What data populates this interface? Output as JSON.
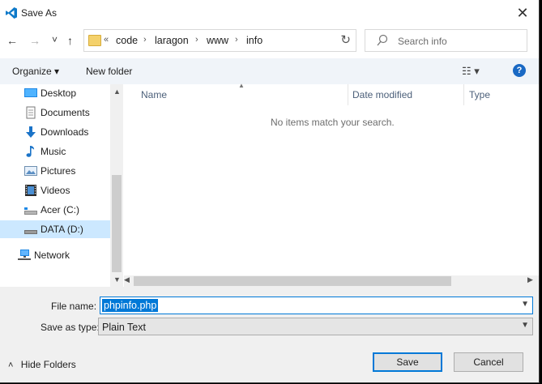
{
  "window": {
    "title": "Save As",
    "close_glyph": "✕"
  },
  "nav": {
    "back": "←",
    "forward": "→",
    "recent": "˅",
    "up": "↑"
  },
  "address": {
    "overflow": "«",
    "crumbs": [
      "code",
      "laragon",
      "www",
      "info"
    ],
    "separator": "›",
    "refresh": "↻"
  },
  "search": {
    "placeholder": "Search info"
  },
  "toolbar": {
    "organize": "Organize ▾",
    "new_folder": "New folder",
    "view": "☷ ▾",
    "help": "?"
  },
  "sidebar": {
    "items": [
      {
        "label": "Desktop",
        "icon": "desktop-icon"
      },
      {
        "label": "Documents",
        "icon": "documents-icon"
      },
      {
        "label": "Downloads",
        "icon": "downloads-icon"
      },
      {
        "label": "Music",
        "icon": "music-icon"
      },
      {
        "label": "Pictures",
        "icon": "pictures-icon"
      },
      {
        "label": "Videos",
        "icon": "videos-icon"
      },
      {
        "label": "Acer (C:)",
        "icon": "drive-icon"
      },
      {
        "label": "DATA (D:)",
        "icon": "drive-icon",
        "selected": true
      },
      {
        "label": "Network",
        "icon": "network-icon"
      }
    ]
  },
  "columns": {
    "name": "Name",
    "date_modified": "Date modified",
    "type": "Type"
  },
  "content": {
    "empty_message": "No items match your search."
  },
  "form": {
    "file_name_label": "File name:",
    "file_name_value": "phpinfo.php",
    "save_type_label": "Save as type:",
    "save_type_value": "Plain Text"
  },
  "footer": {
    "hide_folders": "Hide Folders",
    "hide_glyph": "˄",
    "save": "Save",
    "cancel": "Cancel"
  },
  "colors": {
    "accent": "#0078d7",
    "selection": "#cce8ff",
    "command_bar": "#f0f4f9"
  }
}
